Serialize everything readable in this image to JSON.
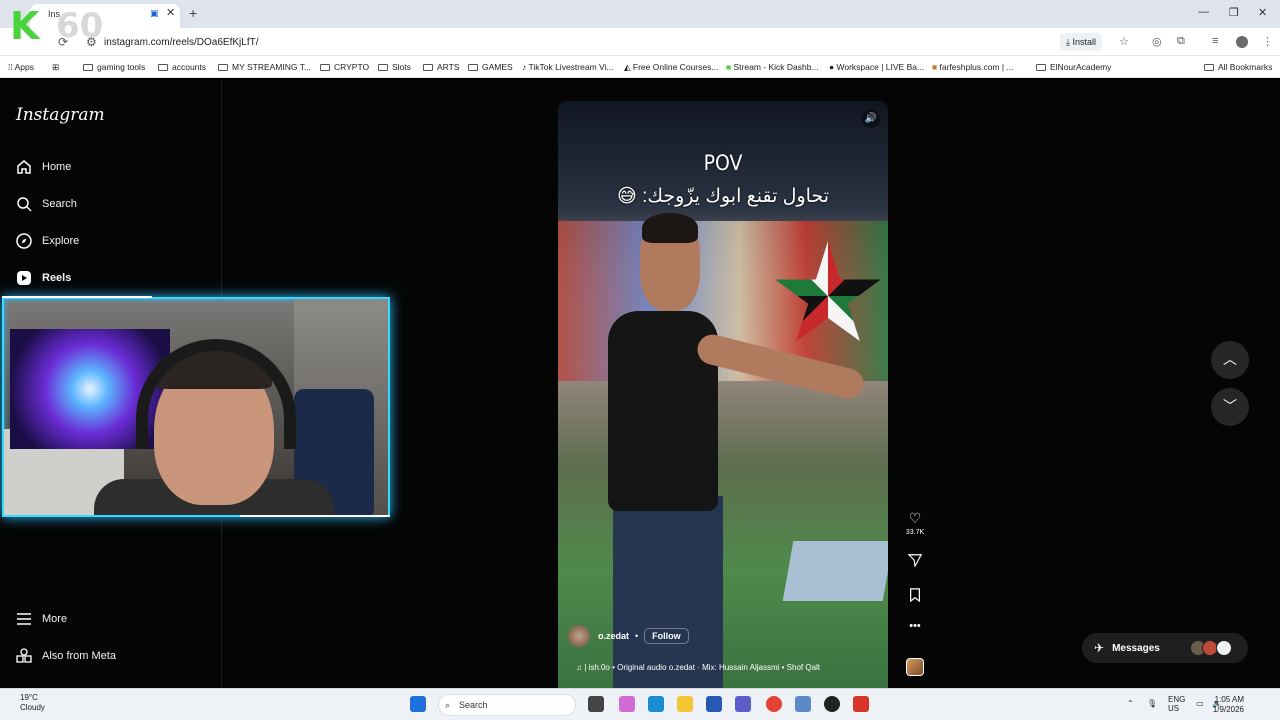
{
  "browser": {
    "tab_title": "Ins",
    "url": "instagram.com/reels/DOa6EfKjLfT/",
    "install_label": "Install",
    "new_tab_symbol": "+",
    "tab_close_symbol": "✕",
    "win_minimize": "—",
    "win_restore": "❐",
    "win_close": "✕"
  },
  "stream_overlay": {
    "logo_letter": "K",
    "counter": "60"
  },
  "bookmarks": [
    {
      "label": "Apps",
      "icon": "apps-grid-icon"
    },
    {
      "label": "",
      "icon": "grid-icon"
    },
    {
      "label": "gaming tools",
      "icon": "folder-icon"
    },
    {
      "label": "accounts",
      "icon": "folder-icon"
    },
    {
      "label": "MY STREAMING T...",
      "icon": "folder-icon"
    },
    {
      "label": "CRYPTO",
      "icon": "folder-icon"
    },
    {
      "label": "Slots",
      "icon": "folder-icon"
    },
    {
      "label": "ARTS",
      "icon": "folder-icon"
    },
    {
      "label": "GAMES",
      "icon": "folder-icon"
    },
    {
      "label": "TikTok Livestream Vi...",
      "icon": "tiktok-icon"
    },
    {
      "label": "Free Online Courses...",
      "icon": "courses-icon"
    },
    {
      "label": "Stream - Kick Dashb...",
      "icon": "kick-icon"
    },
    {
      "label": "Workspace | LIVE Ba...",
      "icon": "tiktok-icon"
    },
    {
      "label": "farfeshplus.com | ...",
      "icon": "site-icon"
    },
    {
      "label": "ElNourAcademy",
      "icon": "folder-icon"
    },
    {
      "label": "All Bookmarks",
      "icon": "folder-icon"
    }
  ],
  "sidebar": {
    "logo": "Instagram",
    "items": [
      {
        "label": "Home",
        "icon": "home-icon"
      },
      {
        "label": "Search",
        "icon": "search-icon"
      },
      {
        "label": "Explore",
        "icon": "explore-icon"
      },
      {
        "label": "Reels",
        "icon": "reels-icon",
        "active": true
      },
      {
        "label": "More",
        "icon": "menu-icon"
      },
      {
        "label": "Also from Meta",
        "icon": "meta-icon"
      }
    ]
  },
  "reel": {
    "overlay_title": "POV",
    "overlay_text": "تحاول تقنع ابوك يزّوجك: 😅",
    "author": "o.zedat",
    "separator": "•",
    "follow_label": "Follow",
    "audio": "| ish.0o • Original audio   o.zedat · Mix: Hussain Aljassmi • Shof Qalt",
    "likes": "33.7K"
  },
  "messages": {
    "label": "Messages"
  },
  "taskbar": {
    "weather_temp": "19°C",
    "weather_desc": "Cloudy",
    "search_label": "Search",
    "lang_line1": "ENG",
    "lang_line2": "US",
    "time": "1:05 AM",
    "date": "1/9/2026"
  },
  "colors": {
    "webcam_border": "#3ad7ff",
    "instagram_bg": "#050505",
    "kick_green": "#4cd23d"
  }
}
